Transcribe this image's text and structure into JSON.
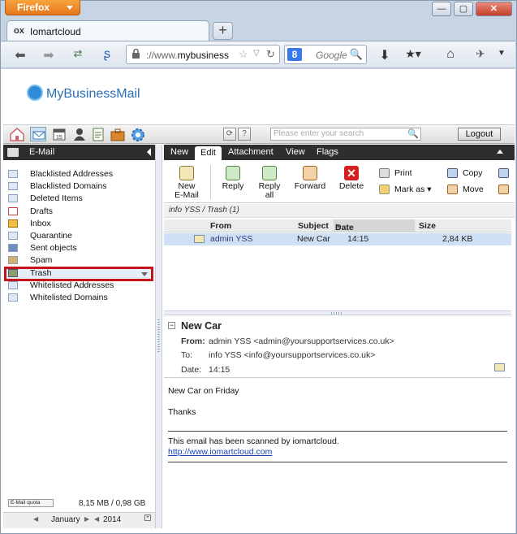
{
  "browser": {
    "app_button": "Firefox",
    "tab_title": "Iomartcloud",
    "tab_icon": "ox",
    "new_tab": "+",
    "url_prefix": "://www.",
    "url_host": "mybusiness",
    "search_engine_letter": "8",
    "search_placeholder": "Google"
  },
  "app": {
    "logo_text": "MyBusinessMail",
    "search_placeholder": "Please enter your search",
    "logout_label": "Logout"
  },
  "sidebar": {
    "title": "E-Mail",
    "folders": [
      {
        "label": "Blacklisted Addresses"
      },
      {
        "label": "Blacklisted Domains"
      },
      {
        "label": "Deleted Items"
      },
      {
        "label": "Drafts"
      },
      {
        "label": "Inbox"
      },
      {
        "label": "Quarantine"
      },
      {
        "label": "Sent objects"
      },
      {
        "label": "Spam"
      },
      {
        "label": "Trash",
        "selected": true
      },
      {
        "label": "Whitelisted Addresses"
      },
      {
        "label": "Whitelisted Domains"
      }
    ],
    "quota_label": "E-Mail quota",
    "quota_value": "8,15 MB / 0,98 GB",
    "calendar": {
      "month": "January",
      "year": "2014"
    }
  },
  "tabs": [
    "New",
    "Edit",
    "Attachment",
    "View",
    "Flags"
  ],
  "active_tab": "Edit",
  "ribbon": {
    "new_email": [
      "New",
      "E-Mail"
    ],
    "reply": "Reply",
    "reply_all": [
      "Reply",
      "all"
    ],
    "forward": "Forward",
    "delete": "Delete",
    "print": "Print",
    "mark_as": "Mark as",
    "copy": "Copy",
    "move": "Move"
  },
  "breadcrumb": "info YSS / Trash (1)",
  "list": {
    "columns": [
      "From",
      "Subject",
      "Date",
      "Size"
    ],
    "rows": [
      {
        "from": "admin YSS",
        "subject": "New Car",
        "date": "14:15",
        "size": "2,84 KB"
      }
    ]
  },
  "message": {
    "subject": "New Car",
    "from_label": "From:",
    "from_value": "admin YSS <admin@yoursupportservices.co.uk>",
    "to_label": "To:",
    "to_value": "info YSS <info@yoursupportservices.co.uk>",
    "date_label": "Date:",
    "date_value": "14:15",
    "body_line1": "New Car on Friday",
    "body_line2": "Thanks",
    "scan_note": "This email has been scanned by iomartcloud.",
    "link": "http://www.iomartcloud.com"
  },
  "colors": {
    "selected_highlight": "#c6121a",
    "header_bar": "#2e2e2e",
    "row_selected": "#cfe0f4",
    "brand": "#2a6fb5"
  }
}
